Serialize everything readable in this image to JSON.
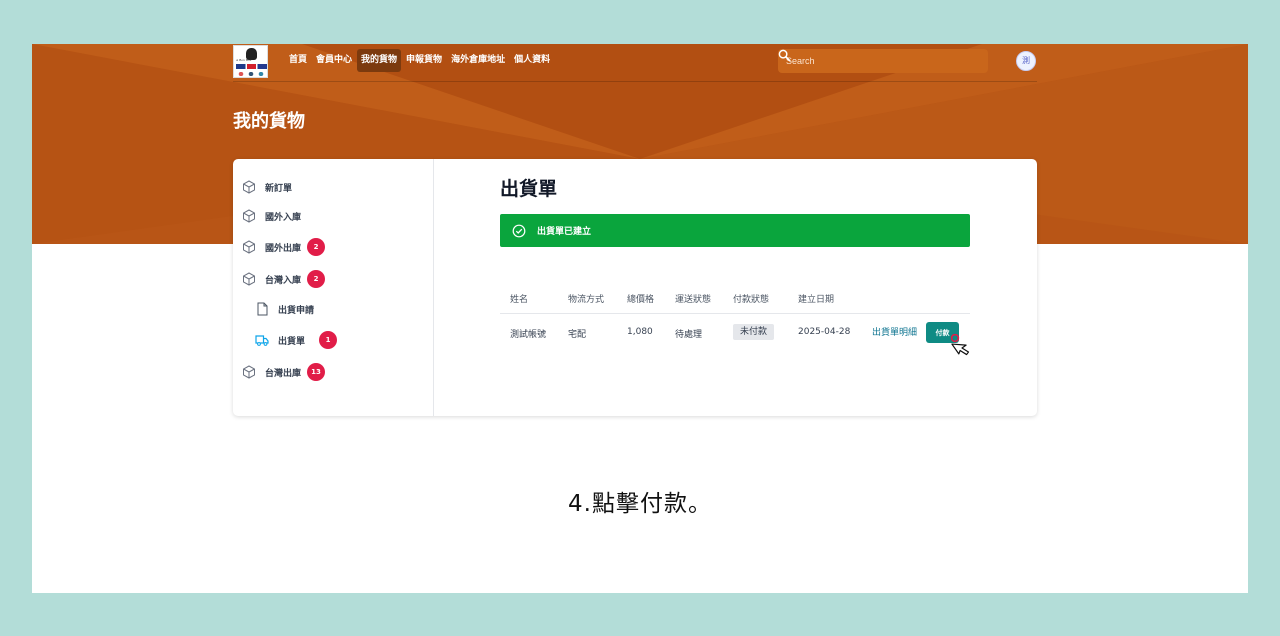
{
  "nav": {
    "items": [
      {
        "label": "首頁",
        "active": false
      },
      {
        "label": "會員中心",
        "active": false
      },
      {
        "label": "我的貨物",
        "active": true
      },
      {
        "label": "申報貨物",
        "active": false
      },
      {
        "label": "海外倉庫地址",
        "active": false
      },
      {
        "label": "個人資料",
        "active": false
      }
    ],
    "search_placeholder": "Search",
    "avatar": "測"
  },
  "page": {
    "title": "我的貨物"
  },
  "sidebar": {
    "items": [
      {
        "label": "新訂單",
        "icon": "box-icon"
      },
      {
        "label": "國外入庫",
        "icon": "box-icon"
      },
      {
        "label": "國外出庫",
        "icon": "box-icon",
        "badge": "2"
      },
      {
        "label": "台灣入庫",
        "icon": "box-icon",
        "badge": "2"
      },
      {
        "label": "出貨申請",
        "icon": "document-icon"
      },
      {
        "label": "出貨單",
        "icon": "truck-icon",
        "badge": "1",
        "active": true
      },
      {
        "label": "台灣出庫",
        "icon": "box-icon",
        "badge": "13"
      }
    ]
  },
  "content": {
    "title": "出貨單",
    "alert": "出貨單已建立"
  },
  "table": {
    "headers": [
      "姓名",
      "物流方式",
      "總價格",
      "運送狀態",
      "付款狀態",
      "建立日期"
    ],
    "row": {
      "name": "測試帳號",
      "shipping": "宅配",
      "total": "1,080",
      "delivery_status": "待處理",
      "payment_status": "未付款",
      "created": "2025-04-28",
      "detail_link": "出貨單明細",
      "pay_button": "付款"
    }
  },
  "caption": "4.點擊付款。",
  "colors": {
    "header_bg": "#b85516",
    "alert_green": "#0aa53d",
    "pay_button": "#0f8b84",
    "badge_red": "#e11d48",
    "backdrop": "#b3ddd8"
  }
}
